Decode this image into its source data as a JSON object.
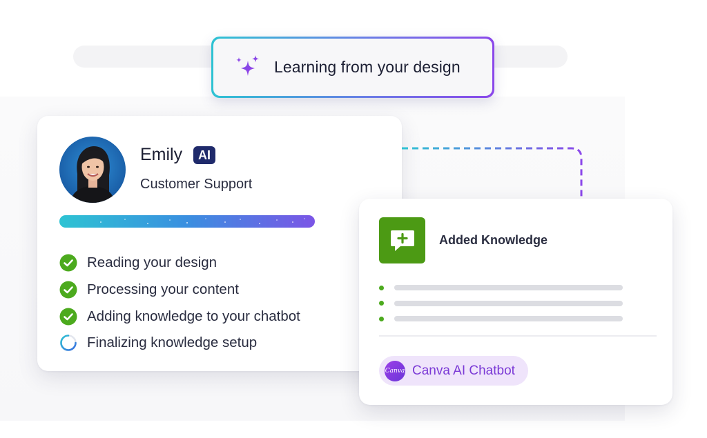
{
  "header": {
    "status_text": "Learning from your design",
    "icon": "sparkles-icon"
  },
  "agent_card": {
    "name": "Emily",
    "badge": "AI",
    "role": "Customer Support",
    "avatar_icon": "avatar-photo",
    "progress": 1.0,
    "steps": [
      {
        "label": "Reading your design",
        "status": "done"
      },
      {
        "label": "Processing your content",
        "status": "done"
      },
      {
        "label": "Adding knowledge to your chatbot",
        "status": "done"
      },
      {
        "label": "Finalizing knowledge setup",
        "status": "loading"
      }
    ]
  },
  "knowledge_card": {
    "title": "Added Knowledge",
    "icon": "add-chat-icon",
    "placeholder_lines": 3,
    "chip": {
      "logo_text": "Canva",
      "label": "Canva AI Chatbot"
    }
  },
  "colors": {
    "accent_cyan": "#2ec3d3",
    "accent_purple": "#8b47ea",
    "badge_navy": "#1f2a6b",
    "success_green": "#4caa1e",
    "knowledge_green": "#4c9a14",
    "chip_bg": "#efe4fb",
    "chip_text": "#7b3ad6"
  }
}
